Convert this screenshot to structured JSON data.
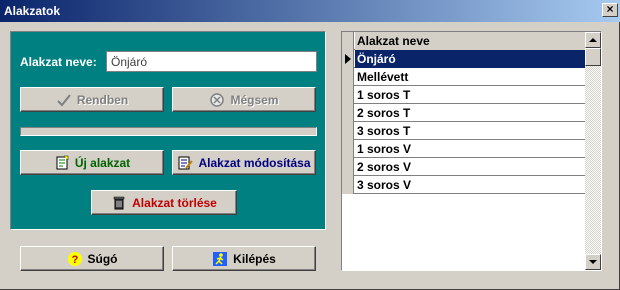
{
  "window": {
    "title": "Alakzatok",
    "close_glyph": "×"
  },
  "form": {
    "name_label": "Alakzat neve:",
    "name_value": "Önjáró"
  },
  "buttons": {
    "ok": "Rendben",
    "cancel": "Mégsem",
    "new_shape": "Új alakzat",
    "modify_shape": "Alakzat módosítása",
    "delete_shape": "Alakzat törlése",
    "help": "Súgó",
    "exit": "Kilépés"
  },
  "colors": {
    "panel": "#008080",
    "new_shape_text": "#006400",
    "modify_shape_text": "#000080",
    "delete_shape_text": "#c00000",
    "selection": "#0a246a"
  },
  "icons": {
    "ok": "checkmark-icon",
    "cancel": "cancel-icon",
    "new_shape": "new-document-icon",
    "modify_shape": "edit-document-icon",
    "delete_shape": "trash-icon",
    "help": "help-icon",
    "exit": "exit-icon"
  },
  "grid": {
    "header": "Alakzat neve",
    "rows": [
      "Önjáró",
      "Mellévett",
      "1 soros T",
      "2 soros T",
      "3 soros T",
      "1 soros V",
      "2 soros V",
      "3 soros V"
    ],
    "selected_index": 0
  }
}
